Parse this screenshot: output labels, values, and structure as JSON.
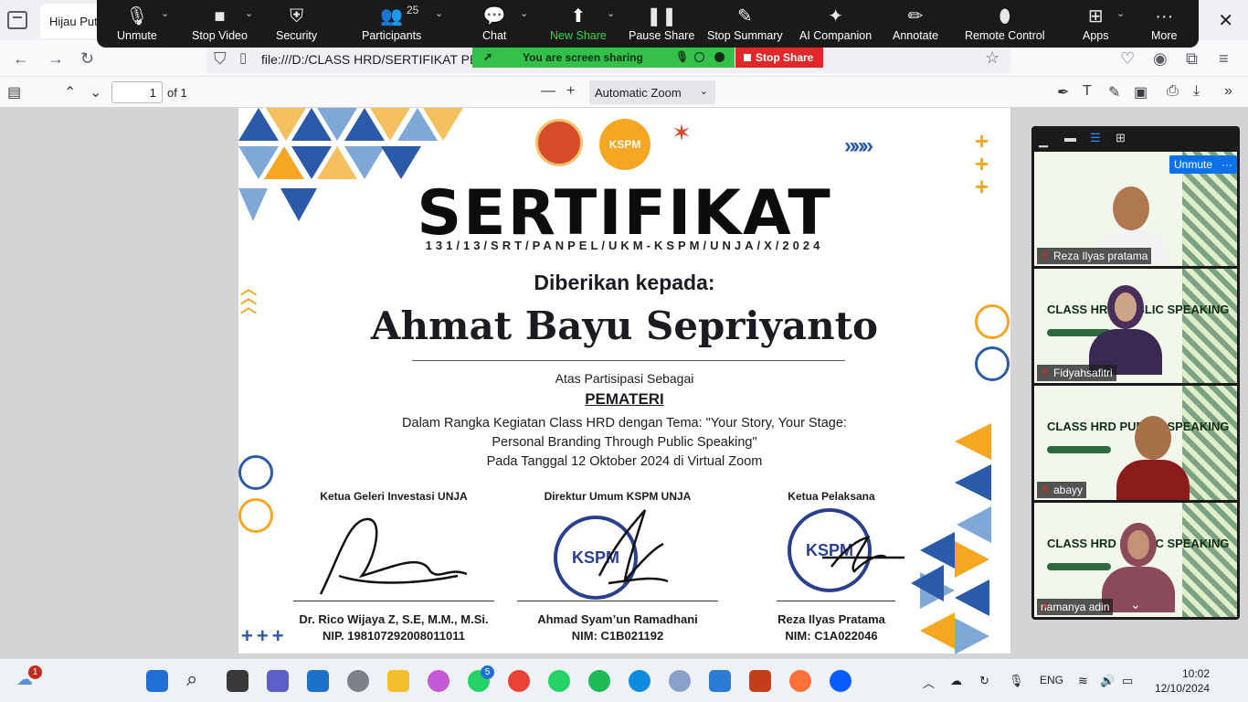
{
  "browser": {
    "tab_title": "Hijau Puti",
    "url": "file:///D:/CLASS HRD/SERTIFIKAT PEMA"
  },
  "zoom_toolbar": {
    "items": [
      "Unmute",
      "Stop Video",
      "Security",
      "Participants",
      "Chat",
      "New Share",
      "Pause Share",
      "Stop Summary",
      "AI Companion",
      "Annotate",
      "Remote Control",
      "Apps",
      "More"
    ],
    "participants_count": "25"
  },
  "share_banner": {
    "status": "You are screen sharing",
    "stop_label": "Stop Share"
  },
  "pdf_toolbar": {
    "page_value": "1",
    "page_total": "of 1",
    "zoom_value": "Automatic Zoom"
  },
  "certificate": {
    "title": "SERTIFIKAT",
    "number": "131/13/SRT/PANPEL/UKM-KSPM/UNJA/X/2024",
    "given_to": "Diberikan kepada:",
    "recipient": "Ahmat Bayu Sepriyanto",
    "as_text": "Atas Partisipasi Sebagai",
    "role": "PEMATERI",
    "description": "Dalam Rangka Kegiatan Class HRD dengan Tema: \"Your Story, Your Stage: Personal Branding Through Public Speaking\"",
    "date_line": "Pada Tanggal 12 Oktober 2024 di Virtual Zoom",
    "logo_text": "KSPM",
    "signatories": [
      {
        "role": "Ketua Geleri Investasi UNJA",
        "name": "Dr. Rico Wijaya Z, S.E, M.M., M.Si.",
        "id": "NIP. 198107292008011011"
      },
      {
        "role": "Direktur Umum KSPM UNJA",
        "name": "Ahmad Syam’un Ramadhani",
        "id": "NIM: C1B021192"
      },
      {
        "role": "Ketua Pelaksana",
        "name": "Reza Ilyas Pratama",
        "id": "NIM: C1A022046"
      }
    ],
    "stamp_text": "KSPM"
  },
  "participants_panel": {
    "unmute_label": "Unmute",
    "more_label": "···",
    "tile_banner": "CLASS HRD PUBLIC SPEAKING",
    "tiles": [
      {
        "name": "Reza Ilyas pratama"
      },
      {
        "name": "Fidyahsafitri"
      },
      {
        "name": "abayy"
      },
      {
        "name": "namanya adin"
      }
    ]
  },
  "taskbar": {
    "weather_badge": "1",
    "whatsapp_badge": "5",
    "language": "ENG",
    "time": "10:02",
    "date": "12/10/2024"
  },
  "colors": {
    "zoom_bg": "#1a1a1a",
    "share_green": "#33c14b",
    "stop_red": "#e02828",
    "cert_blue": "#2b5aa8",
    "cert_orange": "#f5a623"
  }
}
